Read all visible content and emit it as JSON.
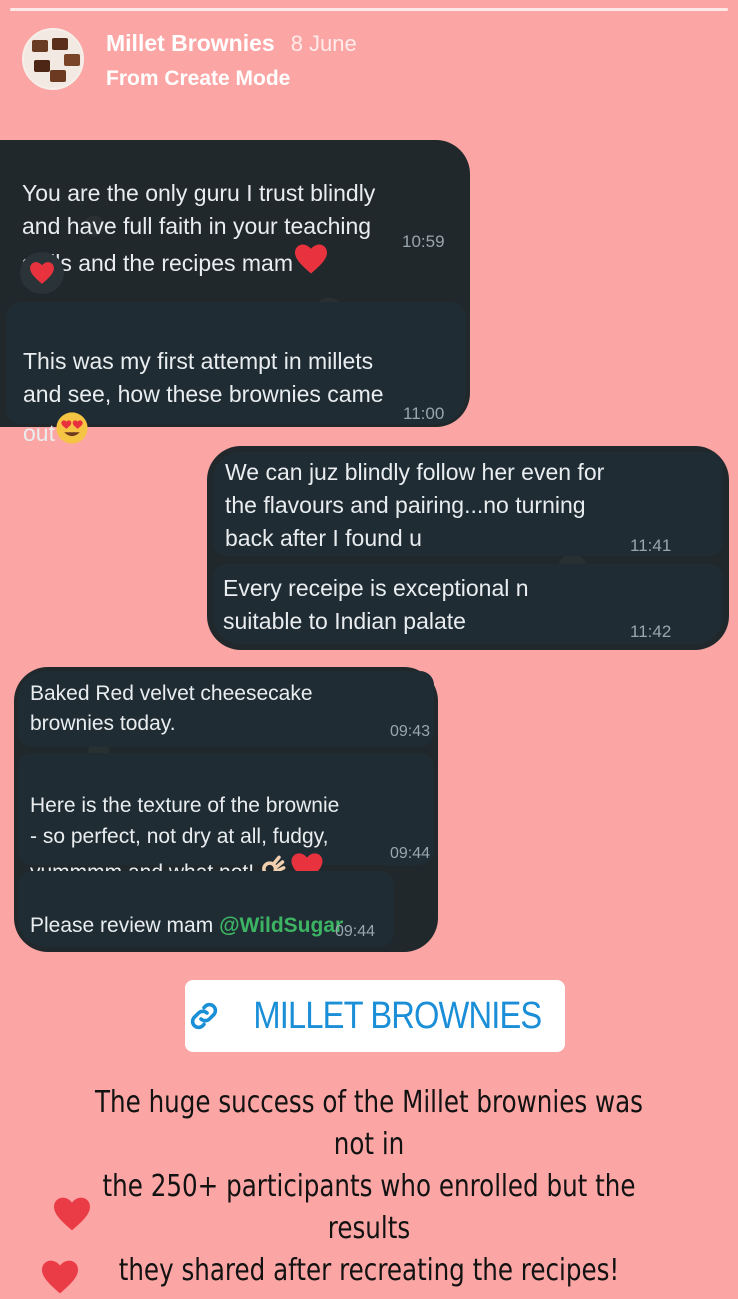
{
  "header": {
    "account_name": "Millet Brownies",
    "date": "8 June",
    "source": "From Create Mode"
  },
  "chat1": {
    "messages": [
      {
        "text": "You are the only guru I trust blindly\nand have full faith in your teaching\nskills and the recipes mam",
        "time": "10:59",
        "emoji": "heart"
      },
      {
        "text": "This was my first attempt in millets\nand see, how these brownies came\nout",
        "time": "11:00",
        "emoji": "heart-eyes"
      }
    ],
    "reaction": "heart"
  },
  "chat2": {
    "messages": [
      {
        "text": "We can juz blindly follow her even for\nthe flavours and pairing...no turning\nback after I found u",
        "time": "11:41"
      },
      {
        "text": "Every receipe is exceptional n\nsuitable to Indian palate",
        "time": "11:42"
      }
    ]
  },
  "chat3": {
    "messages": [
      {
        "text": "Baked Red velvet cheesecake\nbrownies today.",
        "time": "09:43"
      },
      {
        "text": "Here is the texture of the brownie\n- so perfect, not dry at all, fudgy,\nyummmm and what not!",
        "time": "09:44",
        "emoji": "ok-hand-heart"
      },
      {
        "text": "Please review mam ",
        "mention": "@WildSugar",
        "time": "09:44"
      }
    ]
  },
  "link_sticker": {
    "label": "MILLET BROWNIES",
    "icon": "link-icon"
  },
  "caption": "The huge success of the Millet brownies was not in\nthe 250+ participants who enrolled but the results\nthey shared after recreating the recipes!",
  "colors": {
    "background": "#fba6a4",
    "chat_bubble": "#1f2c34",
    "mention": "#3db463",
    "link": "#1a8fd8",
    "heart": "#e8333f"
  }
}
